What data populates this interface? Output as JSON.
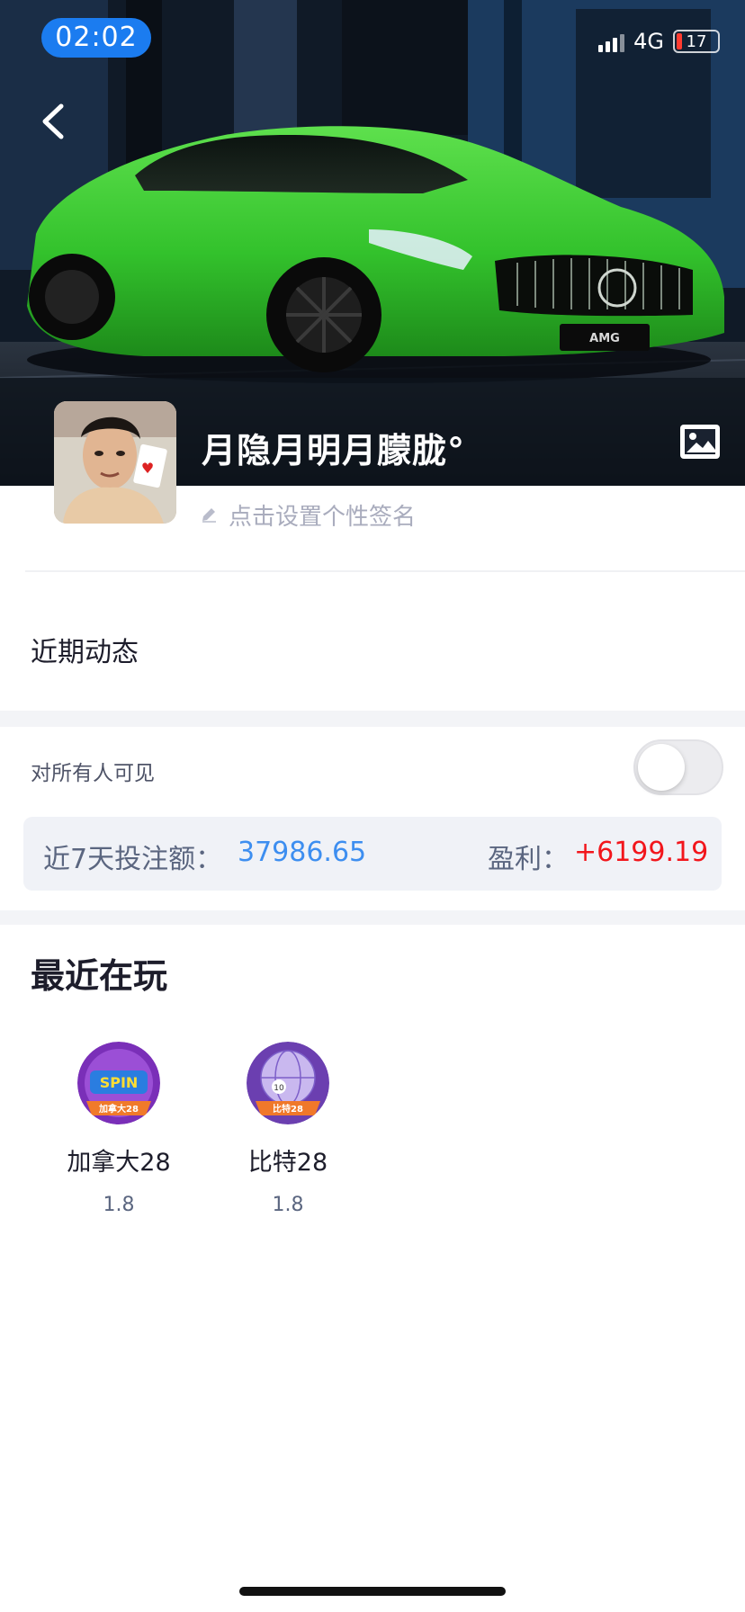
{
  "status_bar": {
    "time": "02:02",
    "network": "4G",
    "battery": "17"
  },
  "profile": {
    "nickname": "月隐月明月朦胧°",
    "signature_placeholder": "点击设置个性签名"
  },
  "recent_activity": {
    "title": "近期动态"
  },
  "visibility": {
    "label": "对所有人可见",
    "enabled": false
  },
  "stats": {
    "bet_label": "近7天投注额：",
    "bet_value": "37986.65",
    "profit_label": "盈利：",
    "profit_value": "+6199.19"
  },
  "recent_games": {
    "title": "最近在玩",
    "items": [
      {
        "name": "加拿大28",
        "odds": "1.8",
        "badge": "加拿大28"
      },
      {
        "name": "比特28",
        "odds": "1.8",
        "badge": "比特28"
      }
    ]
  },
  "colors": {
    "accent_blue": "#3d8ef0",
    "profit_red": "#f2161c",
    "time_pill": "#1b7cf0",
    "car_green": "#3fd03a"
  },
  "icons": {
    "back": "chevron-left-icon",
    "image": "image-icon",
    "edit": "pencil-icon"
  }
}
